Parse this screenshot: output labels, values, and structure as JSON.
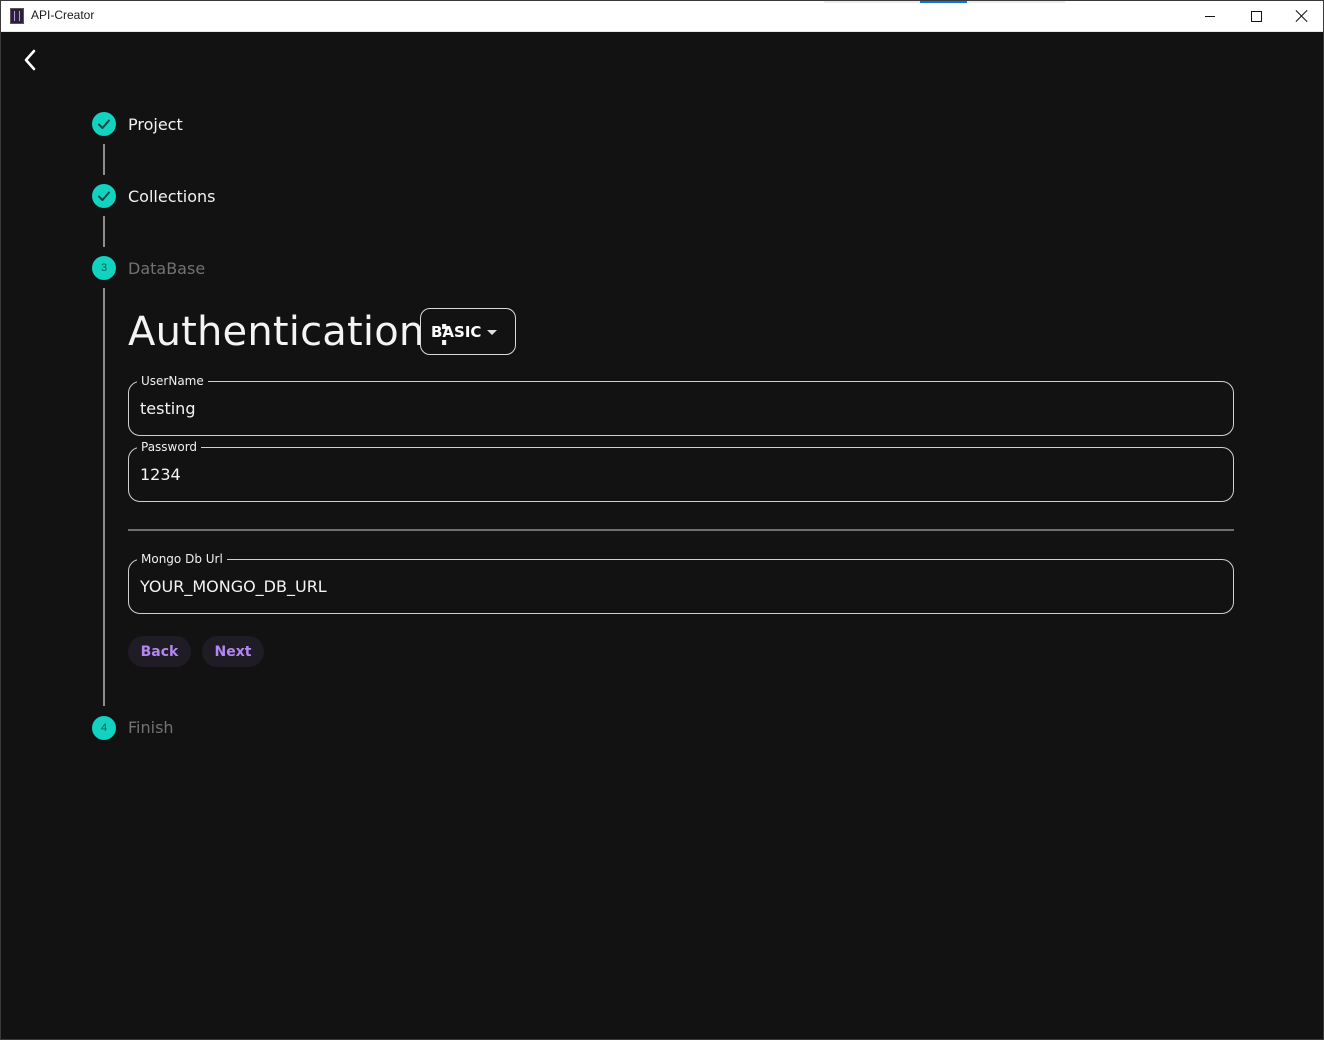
{
  "window": {
    "title": "API-Creator"
  },
  "colors": {
    "background": "#121212",
    "step_accent": "#11d3c0",
    "button_text": "#b387f0",
    "button_bg": "#1f1c26"
  },
  "stepper": {
    "steps": [
      {
        "label": "Project",
        "status": "completed",
        "icon": "check-icon"
      },
      {
        "label": "Collections",
        "status": "completed",
        "icon": "check-icon"
      },
      {
        "label": "DataBase",
        "status": "active",
        "number": "3"
      },
      {
        "label": "Finish",
        "status": "pending",
        "number": "4"
      }
    ]
  },
  "database_form": {
    "auth_title": "Authentication :",
    "auth_type": "BASIC",
    "username": {
      "label": "UserName",
      "value": "testing"
    },
    "password": {
      "label": "Password",
      "value": "1234"
    },
    "mongo_url": {
      "label": "Mongo Db Url",
      "value": "YOUR_MONGO_DB_URL"
    },
    "back_label": "Back",
    "next_label": "Next"
  }
}
